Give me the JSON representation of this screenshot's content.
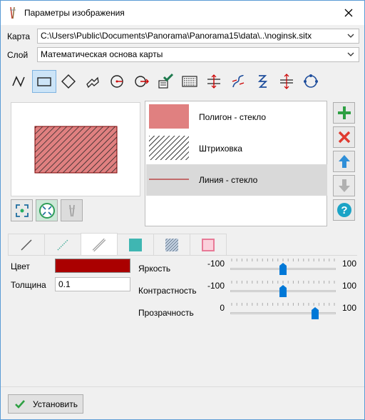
{
  "window": {
    "title": "Параметры изображения",
    "close_icon": "close-icon"
  },
  "map": {
    "label": "Карта",
    "value": "C:\\Users\\Public\\Documents\\Panorama\\Panorama15\\data\\..\\noginsk.sitx"
  },
  "layer": {
    "label": "Слой",
    "value": "Математическая основа карты"
  },
  "toolbar": {
    "tools": [
      "line-tool-icon",
      "rectangle-tool-icon",
      "diamond-tool-icon",
      "arrow-shape-tool-icon",
      "circle-point-tool-icon",
      "circle-arrow-tool-icon",
      "paste-style-tool-icon",
      "hatch-tool-icon",
      "cross-lines-tool-icon",
      "curve-tool-icon",
      "s-curve-tool-icon",
      "double-arrow-tool-icon",
      "circle-refresh-tool-icon"
    ],
    "active_index": 1
  },
  "legend": {
    "items": [
      {
        "label": "Полигон - стекло",
        "swatch": "fill",
        "color": "#e08080"
      },
      {
        "label": "Штриховка",
        "swatch": "hatch",
        "color": "#000000"
      },
      {
        "label": "Линия - стекло",
        "swatch": "line",
        "color": "#aa0000"
      }
    ],
    "selected_index": 2
  },
  "side_buttons": [
    "add-icon",
    "delete-icon",
    "move-up-icon",
    "move-down-icon",
    "help-icon"
  ],
  "tabs": [
    "line-style-tab",
    "dotted-line-tab",
    "glass-line-tab",
    "fill-tab",
    "hatch-tab",
    "glass-fill-tab"
  ],
  "active_tab": 2,
  "props": {
    "color_label": "Цвет",
    "color_value": "#aa0000",
    "thickness_label": "Толщина",
    "thickness_value": "0.1"
  },
  "sliders": [
    {
      "label": "Яркость",
      "min": "-100",
      "max": "100",
      "value": 0
    },
    {
      "label": "Контрастность",
      "min": "-100",
      "max": "100",
      "value": 0
    },
    {
      "label": "Прозрачность",
      "min": "0",
      "max": "100",
      "value": 80
    }
  ],
  "apply_button": {
    "label": "Установить"
  }
}
